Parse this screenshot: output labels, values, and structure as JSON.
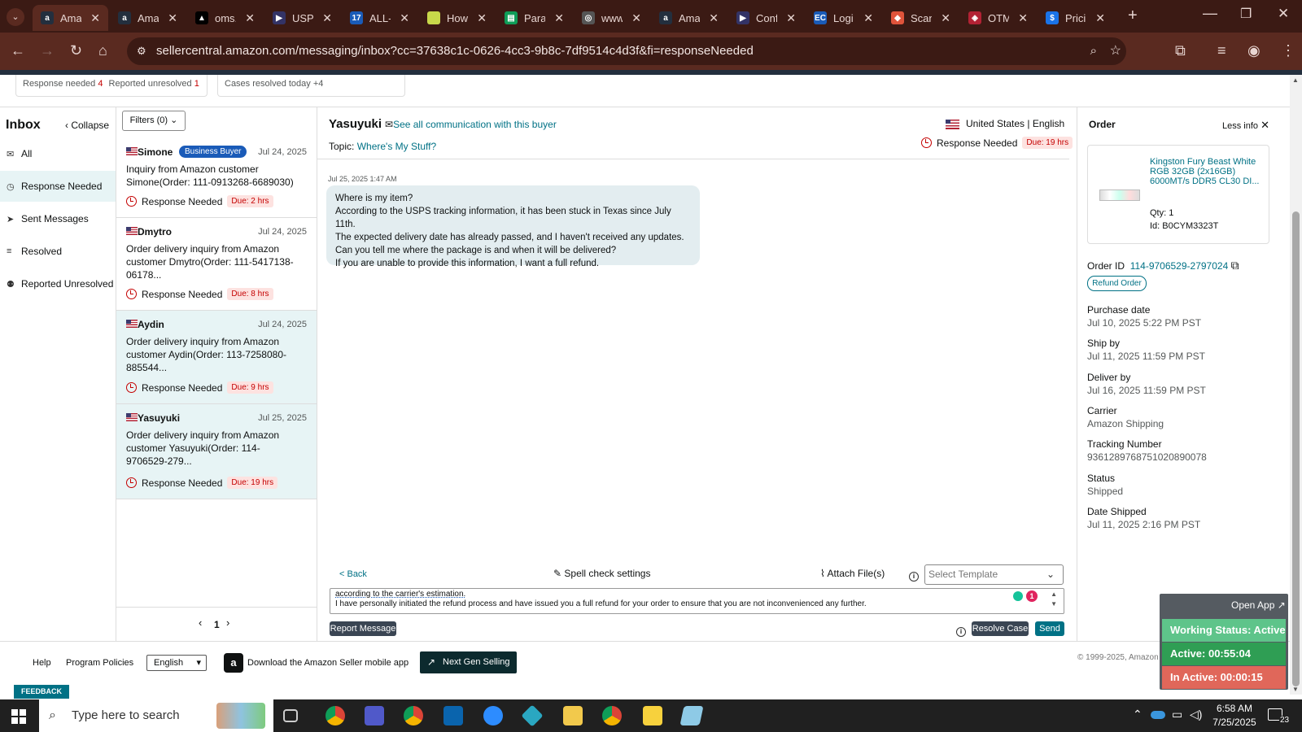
{
  "browser": {
    "tabs": [
      {
        "label": "Ama",
        "color": "#232f3e",
        "glyph": "a"
      },
      {
        "label": "Ama",
        "color": "#232f3e",
        "glyph": "a"
      },
      {
        "label": "oms.",
        "color": "#000",
        "glyph": "▲"
      },
      {
        "label": "USPS",
        "color": "#333366",
        "glyph": "▶"
      },
      {
        "label": "ALL-",
        "color": "#1a5bb8",
        "glyph": "17"
      },
      {
        "label": "How",
        "color": "#c8d84a",
        "glyph": ""
      },
      {
        "label": "Parag",
        "color": "#0f9d58",
        "glyph": "▤"
      },
      {
        "label": "www.",
        "color": "#555",
        "glyph": "◎"
      },
      {
        "label": "Ama",
        "color": "#232f3e",
        "glyph": "a"
      },
      {
        "label": "Conf",
        "color": "#333366",
        "glyph": "▶"
      },
      {
        "label": "Logi",
        "color": "#1a5bb8",
        "glyph": "EC"
      },
      {
        "label": "Scan",
        "color": "#e0543b",
        "glyph": "◆"
      },
      {
        "label": "OTM",
        "color": "#b22234",
        "glyph": "◈"
      },
      {
        "label": "Prici",
        "color": "#1a73e8",
        "glyph": "$"
      }
    ],
    "url": "sellercentral.amazon.com/messaging/inbox?cc=37638c1c-0626-4cc3-9b8c-7df9514c4d3f&fi=responseNeeded"
  },
  "stats": {
    "response_needed_label": "Response needed",
    "response_needed_count": "4",
    "reported_unresolved_label": "Reported unresolved",
    "reported_unresolved_count": "1",
    "cases_resolved": "Cases resolved today +4"
  },
  "sidebar": {
    "title": "Inbox",
    "collapse": "Collapse",
    "items": [
      {
        "label": "All",
        "icon": "✉"
      },
      {
        "label": "Response Needed",
        "icon": "◷"
      },
      {
        "label": "Sent Messages",
        "icon": "➤"
      },
      {
        "label": "Resolved",
        "icon": "≡"
      },
      {
        "label": "Reported Unresolved",
        "icon": "⚉"
      }
    ]
  },
  "filters": "Filters (0)",
  "conversations": [
    {
      "name": "Simone",
      "badge": "Business Buyer",
      "date": "Jul 24, 2025",
      "body": "Inquiry from Amazon customer Simone(Order: 111-0913268-6689030)",
      "status": "Response Needed",
      "due": "Due: 2 hrs"
    },
    {
      "name": "Dmytro",
      "badge": "",
      "date": "Jul 24, 2025",
      "body": "Order delivery inquiry from Amazon customer Dmytro(Order: 111-5417138-06178...",
      "status": "Response Needed",
      "due": "Due: 8 hrs"
    },
    {
      "name": "Aydin",
      "badge": "",
      "date": "Jul 24, 2025",
      "body": "Order delivery inquiry from Amazon customer Aydin(Order: 113-7258080-885544...",
      "status": "Response Needed",
      "due": "Due: 9 hrs"
    },
    {
      "name": "Yasuyuki",
      "badge": "",
      "date": "Jul 25, 2025",
      "body": "Order delivery inquiry from Amazon customer Yasuyuki(Order: 114-9706529-279...",
      "status": "Response Needed",
      "due": "Due: 19 hrs"
    }
  ],
  "pagination": {
    "page": "1"
  },
  "thread": {
    "buyer": "Yasuyuki",
    "see_all": "See all communication with this buyer",
    "country": "United States",
    "language": "English",
    "topic_label": "Topic:",
    "topic": "Where's My Stuff?",
    "status": "Response Needed",
    "due": "Due: 19 hrs",
    "timestamp": "Jul 25, 2025 1:47 AM",
    "message": [
      "Where is my item?",
      "According to the USPS tracking information, it has been stuck in Texas since July 11th.",
      "The expected delivery date has already passed, and I haven't received any updates.",
      "Can you tell me where the package is and when it will be delivered?",
      "If you are unable to provide this information, I want a full refund."
    ]
  },
  "composer": {
    "back": "< Back",
    "spell": "Spell check settings",
    "attach": "Attach File(s)",
    "template_placeholder": "Select Template",
    "line1": "according to the carrier's estimation.",
    "line2": "I have personally initiated the refund process and have issued you a full refund for your order to ensure that you are not inconvenienced any further.",
    "report": "Report Message",
    "resolve": "Resolve Case",
    "send": "Send",
    "error_count": "1"
  },
  "order": {
    "title": "Order",
    "less_info": "Less info",
    "product": "Kingston Fury Beast White RGB 32GB (2x16GB) 6000MT/s DDR5 CL30 DI...",
    "qty": "Qty: 1",
    "id": "Id: B0CYM3323T",
    "order_id_label": "Order ID",
    "order_id": "114-9706529-2797024",
    "refund": "Refund Order",
    "fields": [
      {
        "label": "Purchase date",
        "value": "Jul 10, 2025 5:22 PM PST"
      },
      {
        "label": "Ship by",
        "value": "Jul 11, 2025 11:59 PM PST"
      },
      {
        "label": "Deliver by",
        "value": "Jul 16, 2025 11:59 PM PST"
      },
      {
        "label": "Carrier",
        "value": "Amazon Shipping"
      },
      {
        "label": "Tracking Number",
        "value": "9361289768751020890078"
      },
      {
        "label": "Status",
        "value": "Shipped"
      },
      {
        "label": "Date Shipped",
        "value": "Jul 11, 2025 2:16 PM PST"
      }
    ]
  },
  "footer": {
    "help": "Help",
    "policies": "Program Policies",
    "language": "English",
    "mobile": "Download the Amazon Seller mobile app",
    "next_gen": "Next Gen Selling",
    "copyright": "© 1999-2025, Amazon",
    "feedback": "FEEDBACK"
  },
  "widget": {
    "open_app": "Open App",
    "working": "Working Status: Active",
    "active": "Active: 00:55:04",
    "inactive": "In Active: 00:00:15"
  },
  "taskbar": {
    "search": "Type here to search",
    "time": "6:58 AM",
    "date": "7/25/2025",
    "notif": "23"
  }
}
